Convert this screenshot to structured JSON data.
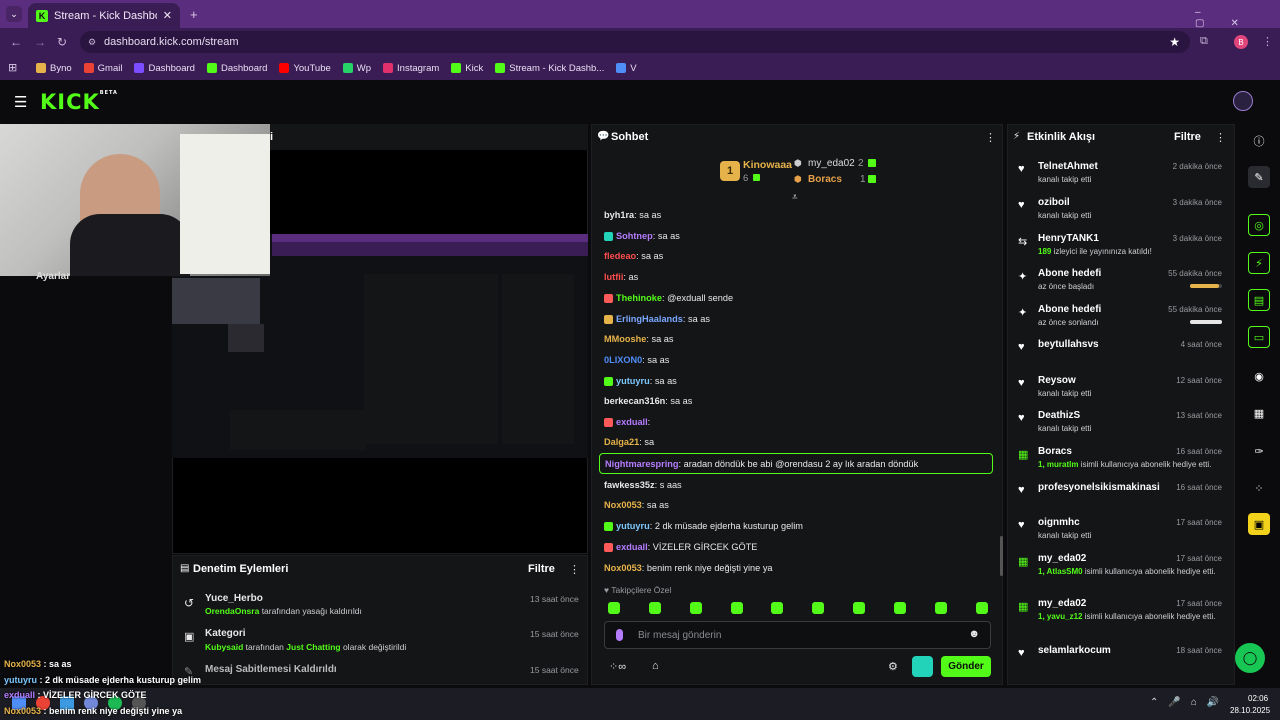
{
  "browser": {
    "tab_title": "Stream - Kick Dashboard",
    "url": "dashboard.kick.com/stream",
    "profile_initial": "B",
    "bookmarks": [
      {
        "label": "Byno",
        "color": "#e6b34a"
      },
      {
        "label": "Gmail",
        "color": "#ea4335"
      },
      {
        "label": "Dashboard",
        "color": "#7c4dff"
      },
      {
        "label": "Dashboard",
        "color": "#53fc18"
      },
      {
        "label": "YouTube",
        "color": "#ff0000"
      },
      {
        "label": "Wp",
        "color": "#25d366"
      },
      {
        "label": "Instagram",
        "color": "#e1306c"
      },
      {
        "label": "Kick",
        "color": "#53fc18"
      },
      {
        "label": "Stream - Kick Dashb...",
        "color": "#53fc18"
      },
      {
        "label": "V",
        "color": "#4f8ef7"
      }
    ]
  },
  "header": {
    "logo": "KICK",
    "beta": "BETA"
  },
  "left_panel": {
    "partial_title": "i",
    "partial_label": "Ayarlar"
  },
  "moderation": {
    "title": "Denetim Eylemleri",
    "filter": "Filtre",
    "items": [
      {
        "user": "Yuce_Herbo",
        "actor": "OrendaOnsra",
        "detail": " tarafından yasağı kaldırıldı",
        "time": "13 saat önce"
      },
      {
        "user": "Kategori",
        "actor": "Kubysaid",
        "detail": " tarafından ",
        "extra": "Just Chatting",
        "extra2": " olarak değiştirildi",
        "time": "15 saat önce"
      },
      {
        "user": "Mesaj Sabitlemesi Kaldırıldı",
        "actor": "",
        "detail": "",
        "time": "15 saat önce"
      }
    ]
  },
  "chat": {
    "title": "Sohbet",
    "leaders": [
      {
        "rank": "1",
        "name": "Kinowaaa",
        "count": "6"
      },
      {
        "name": "my_eda02",
        "count": "2"
      },
      {
        "name": "Boracs",
        "count": "1"
      }
    ],
    "messages": [
      {
        "user": "byh1ra",
        "color": "#e8e8ea",
        "text": "sa as"
      },
      {
        "user": "Sohtnep",
        "color": "#b57cff",
        "text": "sa as"
      },
      {
        "user": "fledeao",
        "color": "#ff4d4d",
        "text": "sa as"
      },
      {
        "user": "lutfii",
        "color": "#ff4d4d",
        "text": "as"
      },
      {
        "user": "Thehinoke",
        "color": "#53fc18",
        "text": "@exduall sende"
      },
      {
        "user": "ErlingHaalands",
        "color": "#7aa7ff",
        "text": "sa as"
      },
      {
        "user": "MMooshe",
        "color": "#e6b34a",
        "text": "sa as"
      },
      {
        "user": "0LIXON0",
        "color": "#4f8ef7",
        "text": "sa as"
      },
      {
        "user": "yutuyru",
        "color": "#7cc8ff",
        "text": "sa as"
      },
      {
        "user": "berkecan316n",
        "color": "#e8e8ea",
        "text": "sa as"
      },
      {
        "user": "exduall",
        "color": "#b57cff",
        "text": ""
      },
      {
        "user": "Dalga21",
        "color": "#e6b34a",
        "text": "sa"
      },
      {
        "user": "Nightmarespring",
        "color": "#b57cff",
        "text": "aradan döndük be abi @orendasu 2 ay lık aradan döndük"
      },
      {
        "user": "fawkess35z",
        "color": "#e8e8ea",
        "text": "s aas"
      },
      {
        "user": "Nox0053",
        "color": "#e6b34a",
        "text": "sa as"
      },
      {
        "user": "yutuyru",
        "color": "#7cc8ff",
        "text": "2 dk müsade ejderha kusturup gelim"
      },
      {
        "user": "exduall",
        "color": "#b57cff",
        "text": "VİZELER GİRCEK GÖTE"
      },
      {
        "user": "Nox0053",
        "color": "#e6b34a",
        "text": "benim renk niye değişti yine ya"
      }
    ],
    "followers_only": "Takipçilere Özel",
    "input_placeholder": "Bir mesaj gönderin",
    "send": "Gönder"
  },
  "activity": {
    "title": "Etkinlik Akışı",
    "filter": "Filtre",
    "items": [
      {
        "icon": "heart",
        "name": "TelnetAhmet",
        "sub": "kanalı takip etti",
        "time": "2 dakika önce"
      },
      {
        "icon": "heart",
        "name": "oziboil",
        "sub": "kanalı takip etti",
        "time": "3 dakika önce"
      },
      {
        "icon": "host",
        "name": "HenryTANK1",
        "sub_accent": "189",
        "sub": " izleyici ile yayınınıza katıldı!",
        "time": "3 dakika önce"
      },
      {
        "icon": "sparkle",
        "name": "Abone hedefi",
        "sub": "az önce başladı",
        "time": "55 dakika önce",
        "progress": 0.9
      },
      {
        "icon": "sparkle",
        "name": "Abone hedefi",
        "sub": "az önce sonlandı",
        "time": "55 dakika önce",
        "progress": 1.0
      },
      {
        "icon": "heart",
        "name": "beytullahsvs",
        "sub": "",
        "time": "4 saat önce"
      },
      {
        "icon": "heart",
        "name": "Reysow",
        "sub": "kanalı takip etti",
        "time": "12 saat önce"
      },
      {
        "icon": "heart",
        "name": "DeathizS",
        "sub": "kanalı takip etti",
        "time": "13 saat önce"
      },
      {
        "icon": "gift",
        "name": "Boracs",
        "sub_accent": "1, muratlm",
        "sub": " isimli kullanıcıya abonelik hediye etti.",
        "time": "16 saat önce"
      },
      {
        "icon": "heart",
        "name": "profesyonelsikismakinasi",
        "sub": "",
        "time": "16 saat önce"
      },
      {
        "icon": "heart",
        "name": "oignmhc",
        "sub": "kanalı takip etti",
        "time": "17 saat önce"
      },
      {
        "icon": "gift",
        "name": "my_eda02",
        "sub_accent": "1, AtlasSM0",
        "sub": " isimli kullanıcıya abonelik hediye etti.",
        "time": "17 saat önce"
      },
      {
        "icon": "gift",
        "name": "my_eda02",
        "sub_accent": "1, yavu_z12",
        "sub": " isimli kullanıcıya abonelik hediye etti.",
        "time": "17 saat önce"
      },
      {
        "icon": "heart",
        "name": "selamlarkocum",
        "sub": "",
        "time": "18 saat önce"
      }
    ]
  },
  "overlay_chat": [
    {
      "user": "Nox0053",
      "color": "#e6b34a",
      "text": " : sa as"
    },
    {
      "user": "yutuyru",
      "color": "#7cc8ff",
      "text": " : 2 dk müsade ejderha kusturup gelim"
    },
    {
      "user": "exduall",
      "color": "#b57cff",
      "text": " : VİZELER GİRCEK GÖTE"
    },
    {
      "user": "Nox0053",
      "color": "#e6b34a",
      "text": " : benim renk niye değişti yine ya"
    }
  ],
  "taskbar": {
    "time": "02:06",
    "date": "28.10.2025"
  },
  "colors": {
    "accent": "#53fc18",
    "browser": "#5b2d7e",
    "panel": "#141517"
  }
}
